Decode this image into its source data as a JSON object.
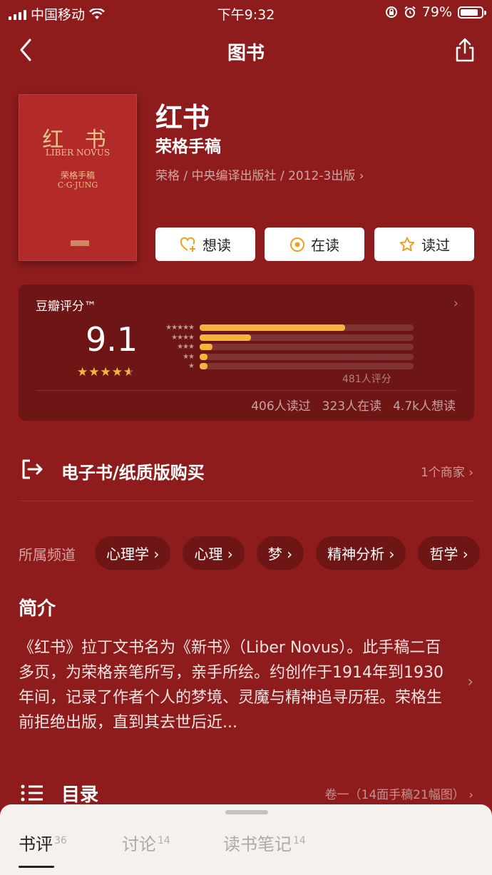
{
  "status_bar": {
    "carrier": "中国移动",
    "time": "下午9:32",
    "battery": "79%"
  },
  "nav": {
    "title": "图书"
  },
  "cover": {
    "title": "红 书",
    "latin": "LIBER NOVUS",
    "subtitle": "荣格手稿",
    "author": "C·G·JUNG"
  },
  "book": {
    "title": "红书",
    "subtitle": "荣格手稿",
    "meta": "荣格 / 中央编译出版社 / 2012-3出版 ›"
  },
  "actions": {
    "want": "想读",
    "reading": "在读",
    "read": "读过"
  },
  "rating": {
    "label": "豆瓣评分™",
    "score": "9.1",
    "stars_display": "★★★★★",
    "star_level": 0.91,
    "distribution": [
      {
        "stars": "★★★★★",
        "fraction": 0.68
      },
      {
        "stars": "★★★★",
        "fraction": 0.24
      },
      {
        "stars": "★★★",
        "fraction": 0.06
      },
      {
        "stars": "★★",
        "fraction": 0.035
      },
      {
        "stars": "★",
        "fraction": 0.035
      }
    ],
    "count": "481人评分",
    "read_count": "406人读过",
    "reading_count": "323人在读",
    "want_count": "4.7k人想读",
    "star_color": "#f4b43e"
  },
  "purchase": {
    "label": "电子书/纸质版购买",
    "merchants": "1个商家 ›"
  },
  "channels": {
    "label": "所属频道",
    "tags": [
      "心理学 ›",
      "心理 ›",
      "梦 ›",
      "精神分析 ›",
      "哲学 ›"
    ]
  },
  "intro": {
    "title": "简介",
    "text": "《红书》拉丁文书名为《新书》（Liber Novus）。此手稿二百多页，为荣格亲笔所写，亲手所绘。约创作于1914年到1930年间，记录了作者个人的梦境、灵魔与精神追寻历程。荣格生前拒绝出版，直到其去世后近..."
  },
  "toc": {
    "label": "目录",
    "summary": "卷一（14面手稿21幅图） ›"
  },
  "tabs": [
    {
      "label": "书评",
      "count": "36"
    },
    {
      "label": "讨论",
      "count": "14"
    },
    {
      "label": "读书笔记",
      "count": "14"
    }
  ]
}
